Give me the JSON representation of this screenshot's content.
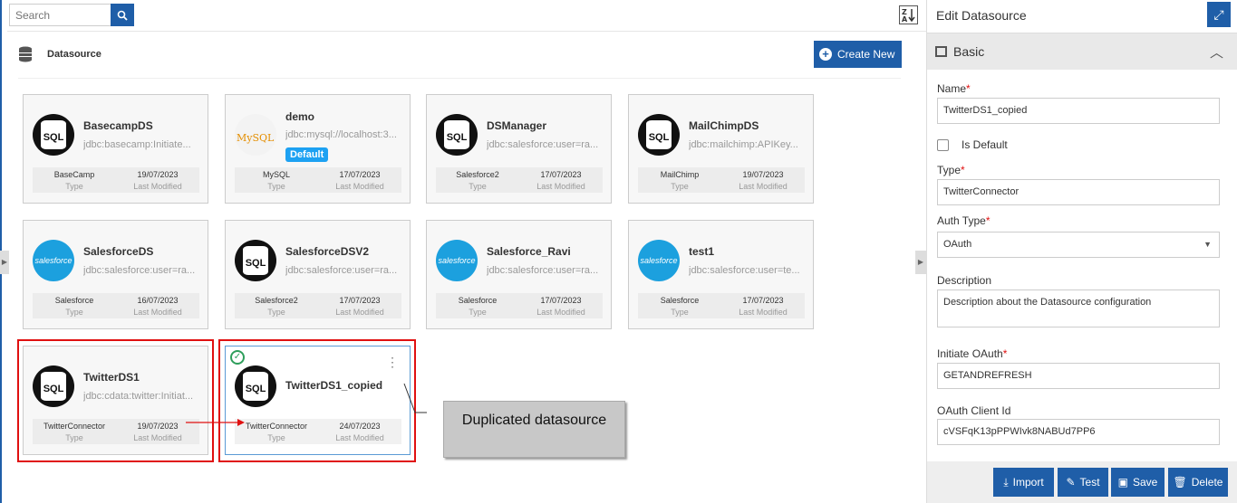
{
  "search": {
    "placeholder": "Search"
  },
  "header": {
    "section_title": "Datasource",
    "create_label": "Create New"
  },
  "cards": [
    {
      "name": "BasecampDS",
      "url": "jdbc:basecamp:Initiate...",
      "type": "BaseCamp",
      "date": "19/07/2023",
      "logo": "sql"
    },
    {
      "name": "demo",
      "url": "jdbc:mysql://localhost:3...",
      "type": "MySQL",
      "date": "17/07/2023",
      "logo": "mysql",
      "badge": "Default"
    },
    {
      "name": "DSManager",
      "url": "jdbc:salesforce:user=ra...",
      "type": "Salesforce2",
      "date": "17/07/2023",
      "logo": "sql"
    },
    {
      "name": "MailChimpDS",
      "url": "jdbc:mailchimp:APIKey...",
      "type": "MailChimp",
      "date": "19/07/2023",
      "logo": "sql"
    },
    {
      "name": "SalesforceDS",
      "url": "jdbc:salesforce:user=ra...",
      "type": "Salesforce",
      "date": "16/07/2023",
      "logo": "salesforce"
    },
    {
      "name": "SalesforceDSV2",
      "url": "jdbc:salesforce:user=ra...",
      "type": "Salesforce2",
      "date": "17/07/2023",
      "logo": "sql"
    },
    {
      "name": "Salesforce_Ravi",
      "url": "jdbc:salesforce:user=ra...",
      "type": "Salesforce",
      "date": "17/07/2023",
      "logo": "salesforce"
    },
    {
      "name": "test1",
      "url": "jdbc:salesforce:user=te...",
      "type": "Salesforce",
      "date": "17/07/2023",
      "logo": "salesforce"
    },
    {
      "name": "TwitterDS1",
      "url": "jdbc:cdata:twitter:Initiat...",
      "type": "TwitterConnector",
      "date": "19/07/2023",
      "logo": "sql"
    },
    {
      "name": "TwitterDS1_copied",
      "url": "",
      "type": "TwitterConnector",
      "date": "24/07/2023",
      "logo": "sql",
      "selected": true
    }
  ],
  "labels": {
    "type": "Type",
    "modified": "Last Modified"
  },
  "logo_text": {
    "sql": "SQL",
    "mysql": "MySQL",
    "salesforce": "salesforce"
  },
  "annotation": {
    "text": "Duplicated datasource"
  },
  "panel": {
    "title": "Edit Datasource",
    "section": "Basic",
    "name_label": "Name",
    "name_value": "TwitterDS1_copied",
    "default_label": "Is Default",
    "type_label": "Type",
    "type_value": "TwitterConnector",
    "auth_label": "Auth Type",
    "auth_value": "OAuth",
    "desc_label": "Description",
    "desc_value": "Description about the Datasource configuration",
    "initiate_label": "Initiate OAuth",
    "initiate_value": "GETANDREFRESH",
    "client_label": "OAuth Client Id",
    "client_value": "cVSFqK13pPPWIvk8NABUd7PP6"
  },
  "buttons": {
    "import": "Import",
    "test": "Test",
    "save": "Save",
    "delete": "Delete"
  },
  "colors": {
    "primary": "#1f5ea8",
    "required": "#e01010",
    "highlight": "#e01010",
    "selected_border": "#5b9bd5"
  }
}
